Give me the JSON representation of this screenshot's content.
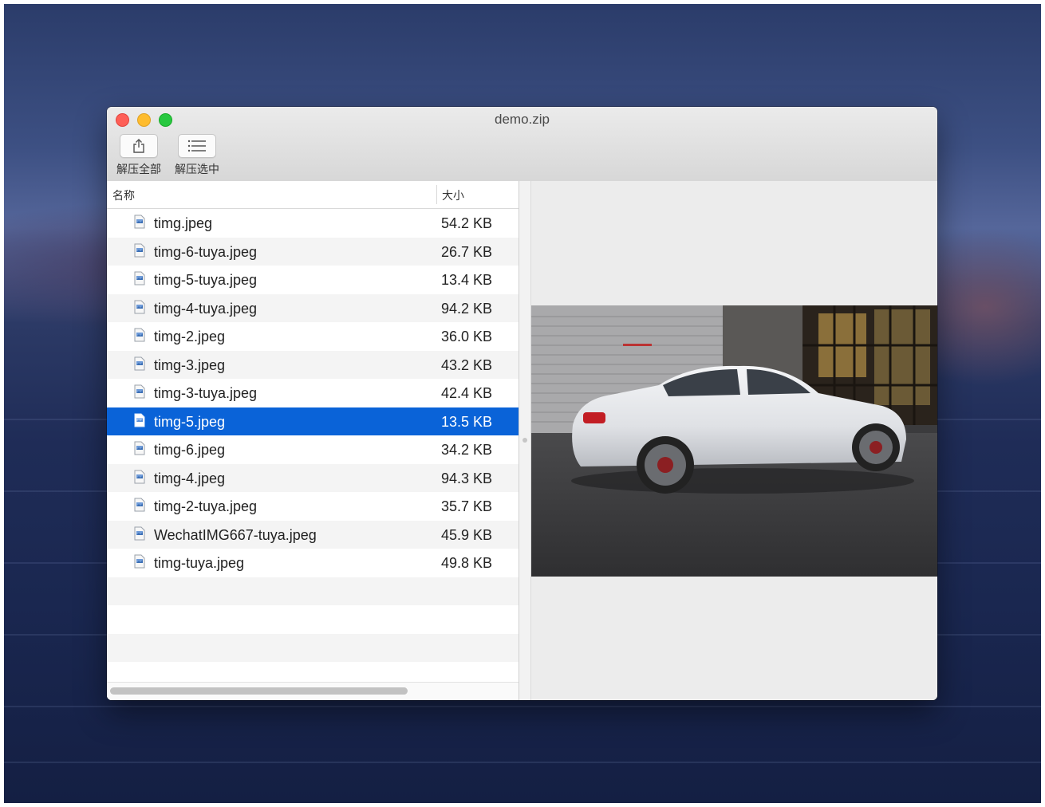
{
  "window": {
    "title": "demo.zip"
  },
  "toolbar": {
    "extract_all_label": "解压全部",
    "extract_selected_label": "解压选中",
    "extract_all_icon": "share-icon",
    "extract_selected_icon": "list-icon"
  },
  "columns": {
    "name": "名称",
    "size": "大小"
  },
  "files": [
    {
      "name": "timg.jpeg",
      "size": "54.2 KB"
    },
    {
      "name": "timg-6-tuya.jpeg",
      "size": "26.7 KB"
    },
    {
      "name": "timg-5-tuya.jpeg",
      "size": "13.4 KB"
    },
    {
      "name": "timg-4-tuya.jpeg",
      "size": "94.2 KB"
    },
    {
      "name": "timg-2.jpeg",
      "size": "36.0 KB"
    },
    {
      "name": "timg-3.jpeg",
      "size": "43.2 KB"
    },
    {
      "name": "timg-3-tuya.jpeg",
      "size": "42.4 KB"
    },
    {
      "name": "timg-5.jpeg",
      "size": "13.5 KB",
      "selected": true
    },
    {
      "name": "timg-6.jpeg",
      "size": "34.2 KB"
    },
    {
      "name": "timg-4.jpeg",
      "size": "94.3 KB"
    },
    {
      "name": "timg-2-tuya.jpeg",
      "size": "35.7 KB"
    },
    {
      "name": "WechatIMG667-tuya.jpeg",
      "size": "45.9 KB"
    },
    {
      "name": "timg-tuya.jpeg",
      "size": "49.8 KB"
    }
  ],
  "colors": {
    "selection": "#0a63d8",
    "close": "#fe5f57",
    "minimize": "#febc2e",
    "maximize": "#28c840"
  },
  "preview": {
    "image": "white-sedan-photo"
  }
}
